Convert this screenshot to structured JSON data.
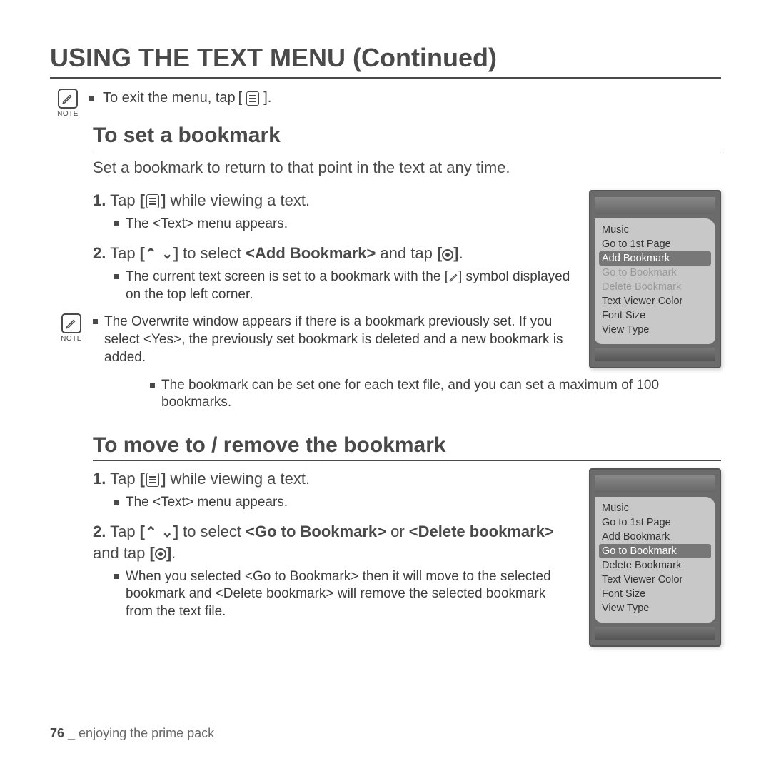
{
  "title": "USING THE TEXT MENU (Continued)",
  "exit_note": "To exit the menu, tap",
  "note_label": "NOTE",
  "section1": {
    "heading": "To set a bookmark",
    "intro": "Set a bookmark to return to that point in the text at any time.",
    "step1_pre": "Tap ",
    "step1_post": " while viewing a text.",
    "step1_sub": "The <Text> menu appears.",
    "step2_pre": "Tap ",
    "step2_mid": " to select ",
    "step2_bold": "<Add Bookmark>",
    "step2_post": " and tap ",
    "sub2a_pre": "The current text screen is set to a bookmark with the ",
    "sub2a_post": " symbol displayed on the top left corner.",
    "note_sub1": "The Overwrite window appears if there is a bookmark previously set. If you select <Yes>, the previously set bookmark is deleted and a new bookmark is added.",
    "note_sub2": "The bookmark can be set one for each text file, and you can set a maximum of 100 bookmarks."
  },
  "section2": {
    "heading": "To move to / remove the bookmark",
    "step1_pre": "Tap ",
    "step1_post": " while viewing a text.",
    "step1_sub": "The <Text> menu appears.",
    "step2_pre": "Tap ",
    "step2_mid": " to select ",
    "step2_bold1": "<Go to Bookmark>",
    "step2_or": " or ",
    "step2_bold2": "<Delete bookmark>",
    "step2_post": " and tap ",
    "sub": "When you selected <Go to Bookmark> then it will move to the selected bookmark and <Delete bookmark> will remove the selected bookmark from the text file."
  },
  "device_menu": {
    "items": [
      "Music",
      "Go to 1st Page",
      "Add Bookmark",
      "Go to Bookmark",
      "Delete Bookmark",
      "Text Viewer Color",
      "Font Size",
      "View Type"
    ],
    "selected_a": 2,
    "selected_b": 3,
    "dimmed_a": [
      3,
      4
    ]
  },
  "footer": {
    "page": "76",
    "sep": " _ ",
    "chapter": "enjoying the prime pack"
  }
}
